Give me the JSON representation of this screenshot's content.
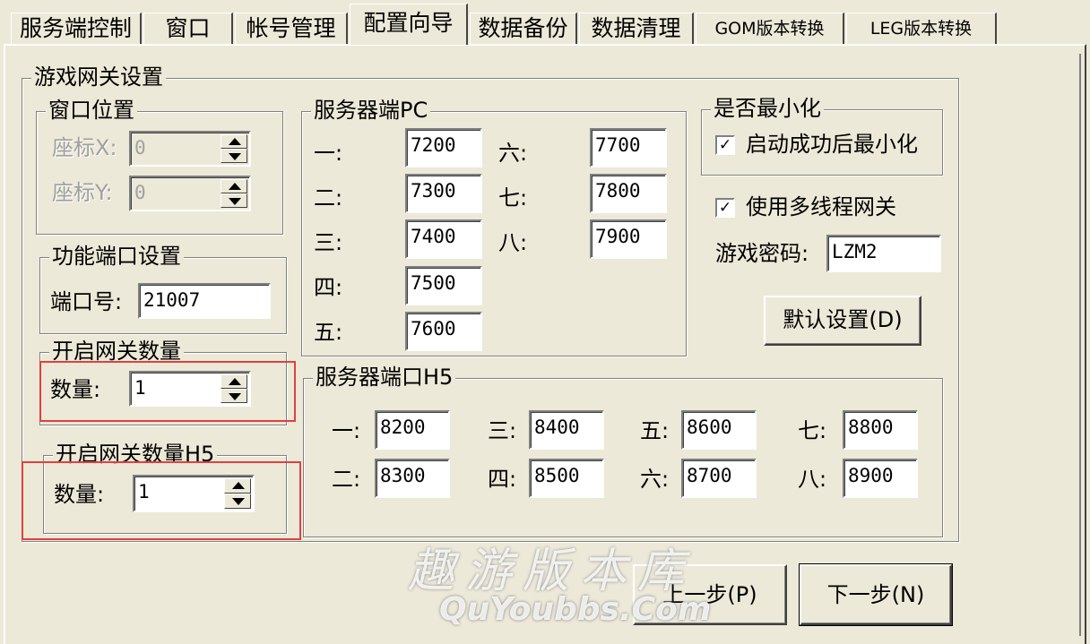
{
  "tabs": [
    {
      "label": "服务端控制"
    },
    {
      "label": "窗口"
    },
    {
      "label": "帐号管理"
    },
    {
      "label": "配置向导"
    },
    {
      "label": "数据备份"
    },
    {
      "label": "数据清理"
    },
    {
      "label": "GOM版本转换"
    },
    {
      "label": "LEG版本转换"
    }
  ],
  "active_tab": "配置向导",
  "gateway": {
    "title": "游戏网关设置",
    "window_pos": {
      "title": "窗口位置",
      "x_label": "座标X:",
      "x_value": "0",
      "y_label": "座标Y:",
      "y_value": "0"
    },
    "func_port": {
      "title": "功能端口设置",
      "port_label": "端口号:",
      "port_value": "21007"
    },
    "gate_count": {
      "title": "开启网关数量",
      "count_label": "数量:",
      "count_value": "1"
    },
    "gate_count_h5": {
      "title": "开启网关数量H5",
      "count_label": "数量:",
      "count_value": "1"
    },
    "server_pc": {
      "title": "服务器端PC",
      "ports": [
        {
          "label": "一:",
          "value": "7200"
        },
        {
          "label": "二:",
          "value": "7300"
        },
        {
          "label": "三:",
          "value": "7400"
        },
        {
          "label": "四:",
          "value": "7500"
        },
        {
          "label": "五:",
          "value": "7600"
        },
        {
          "label": "六:",
          "value": "7700"
        },
        {
          "label": "七:",
          "value": "7800"
        },
        {
          "label": "八:",
          "value": "7900"
        }
      ]
    },
    "server_h5": {
      "title": "服务器端口H5",
      "ports": [
        {
          "label": "一:",
          "value": "8200"
        },
        {
          "label": "二:",
          "value": "8300"
        },
        {
          "label": "三:",
          "value": "8400"
        },
        {
          "label": "四:",
          "value": "8500"
        },
        {
          "label": "五:",
          "value": "8600"
        },
        {
          "label": "六:",
          "value": "8700"
        },
        {
          "label": "七:",
          "value": "8800"
        },
        {
          "label": "八:",
          "value": "8900"
        }
      ]
    },
    "minimize": {
      "title": "是否最小化",
      "checkbox_label": "启动成功后最小化",
      "checked": true
    },
    "multithread": {
      "checkbox_label": "使用多线程网关",
      "checked": true
    },
    "password": {
      "label": "游戏密码:",
      "value": "LZM2"
    },
    "default_button": "默认设置(D)"
  },
  "nav": {
    "prev": "上一步(P)",
    "next": "下一步(N)"
  },
  "watermark": {
    "line1": "趣游版本库",
    "line2": "QuYoubbs.Com"
  },
  "colors": {
    "face": "#ece9d8",
    "annotation": "#e04040"
  },
  "icons": {
    "check": "checkmark",
    "spin_up": "triangle-up",
    "spin_down": "triangle-down"
  }
}
